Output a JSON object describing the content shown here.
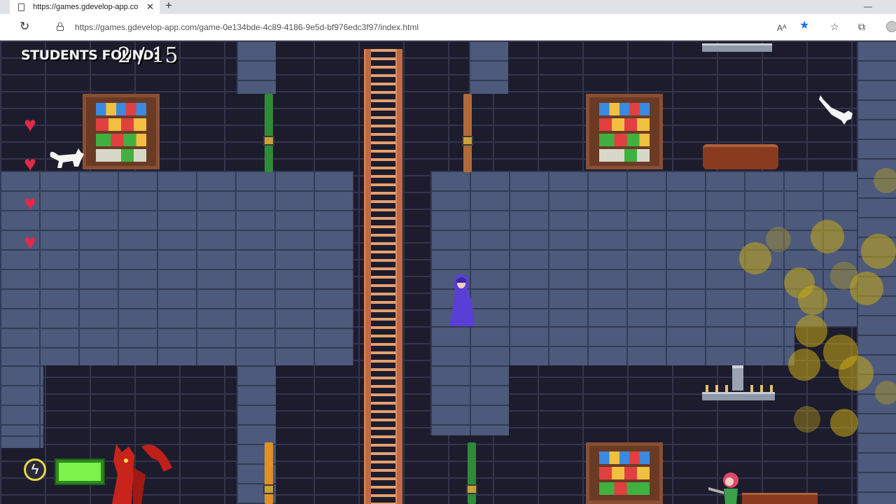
{
  "browser": {
    "tab_title": "https://games.gdevelop-app.com",
    "tab_close": "✕",
    "new_tab": "+",
    "url": "https://games.gdevelop-app.com/game-0e134bde-4c89-4186-9e5d-bf976edc3f97/index.html",
    "reload_icon": "reload-icon",
    "read_aloud": "Aᴬ"
  },
  "hud": {
    "students_label": "STUDENTS FOUND:",
    "students_count": "2 / 15",
    "lives": 4,
    "energy_level": 1.0
  },
  "colors": {
    "wall": "#4d5a7b",
    "background": "#1d1c2d",
    "heart": "#e02a4a",
    "energy": "#7cf24a",
    "ladder": "#c06a44",
    "wizard": "#5a3fd6"
  }
}
